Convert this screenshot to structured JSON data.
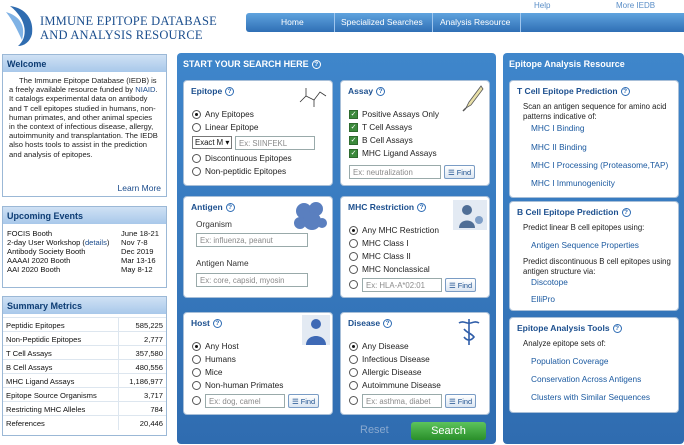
{
  "header": {
    "logo_line1": "IMMUNE EPITOPE DATABASE",
    "logo_line2": "AND ANALYSIS RESOURCE",
    "help": "Help",
    "more": "More IEDB",
    "nav": [
      "Home",
      "Specialized Searches",
      "Analysis Resource"
    ]
  },
  "welcome": {
    "title": "Welcome",
    "text_pre": "The Immune Epitope Database (IEDB) is a freely available resource funded by",
    "niaid": "NIAID",
    "text_post": ". It catalogs experimental data on antibody and T cell epitopes studied in humans, non-human primates, and other animal species in the context of infectious disease, allergy, autoimmunity and transplantation. The IEDB also hosts tools to assist in the prediction and analysis of epitopes.",
    "learn_more": "Learn More"
  },
  "events": {
    "title": "Upcoming Events",
    "items": [
      {
        "name": "FOCIS Booth",
        "date": "June 18-21"
      },
      {
        "name_pre": "2-day User Workshop (",
        "link": "details",
        "name_post": ")",
        "date": "Nov 7-8"
      },
      {
        "name": "Antibody Society Booth",
        "date": "Dec 2019"
      },
      {
        "name": "AAAAI 2020 Booth",
        "date": "Mar 13-16"
      },
      {
        "name": "AAI 2020 Booth",
        "date": "May 8-12"
      }
    ]
  },
  "metrics": {
    "title": "Summary Metrics",
    "rows": [
      {
        "label": "Peptidic Epitopes",
        "value": "585,225"
      },
      {
        "label": "Non-Peptidic Epitopes",
        "value": "2,777"
      },
      {
        "label": "T Cell Assays",
        "value": "357,580"
      },
      {
        "label": "B Cell Assays",
        "value": "480,556"
      },
      {
        "label": "MHC Ligand Assays",
        "value": "1,186,977"
      },
      {
        "label": "Epitope Source Organisms",
        "value": "3,717"
      },
      {
        "label": "Restricting MHC Alleles",
        "value": "784"
      },
      {
        "label": "References",
        "value": "20,446"
      }
    ]
  },
  "search": {
    "title": "START YOUR SEARCH HERE",
    "help": "?",
    "find": "Find",
    "reset": "Reset",
    "search": "Search",
    "epitope": {
      "title": "Epitope",
      "options": [
        "Any Epitopes",
        "Linear Epitope",
        "Discontinuous Epitopes",
        "Non-peptidic Epitopes"
      ],
      "select": "Exact M",
      "placeholder": "Ex: SIINFEKL"
    },
    "assay": {
      "title": "Assay",
      "options": [
        "Positive Assays Only",
        "T Cell Assays",
        "B Cell Assays",
        "MHC Ligand Assays"
      ],
      "placeholder": "Ex: neutralization"
    },
    "antigen": {
      "title": "Antigen",
      "organism": "Organism",
      "org_ph": "Ex: influenza, peanut",
      "name": "Antigen Name",
      "name_ph": "Ex: core, capsid, myosin"
    },
    "mhc": {
      "title": "MHC Restriction",
      "options": [
        "Any MHC Restriction",
        "MHC Class I",
        "MHC Class II",
        "MHC Nonclassical"
      ],
      "placeholder": "Ex: HLA-A*02:01"
    },
    "host": {
      "title": "Host",
      "options": [
        "Any Host",
        "Humans",
        "Mice",
        "Non-human Primates"
      ],
      "placeholder": "Ex: dog, camel"
    },
    "disease": {
      "title": "Disease",
      "options": [
        "Any Disease",
        "Infectious Disease",
        "Allergic Disease",
        "Autoimmune Disease"
      ],
      "placeholder": "Ex: asthma, diabet"
    }
  },
  "tools": {
    "title": "Epitope Analysis Resource",
    "tcell": {
      "title": "T Cell Epitope Prediction",
      "text": "Scan an antigen sequence for amino acid patterns indicative of:",
      "links": [
        "MHC I Binding",
        "MHC II Binding",
        "MHC I Processing (Proteasome,TAP)",
        "MHC I Immunogenicity"
      ]
    },
    "bcell": {
      "title": "B Cell Epitope Prediction",
      "text1": "Predict linear B cell epitopes using:",
      "link1": "Antigen Sequence Properties",
      "text2": "Predict discontinuous B cell epitopes using antigen structure via:",
      "links": [
        "Discotope",
        "ElliPro"
      ]
    },
    "analysis": {
      "title": "Epitope Analysis Tools",
      "text": "Analyze epitope sets of:",
      "links": [
        "Population Coverage",
        "Conservation Across Antigens",
        "Clusters with Similar Sequences"
      ]
    }
  },
  "colors": {
    "accent": "#2f6cb0",
    "search_green": "#2a8f2a"
  }
}
